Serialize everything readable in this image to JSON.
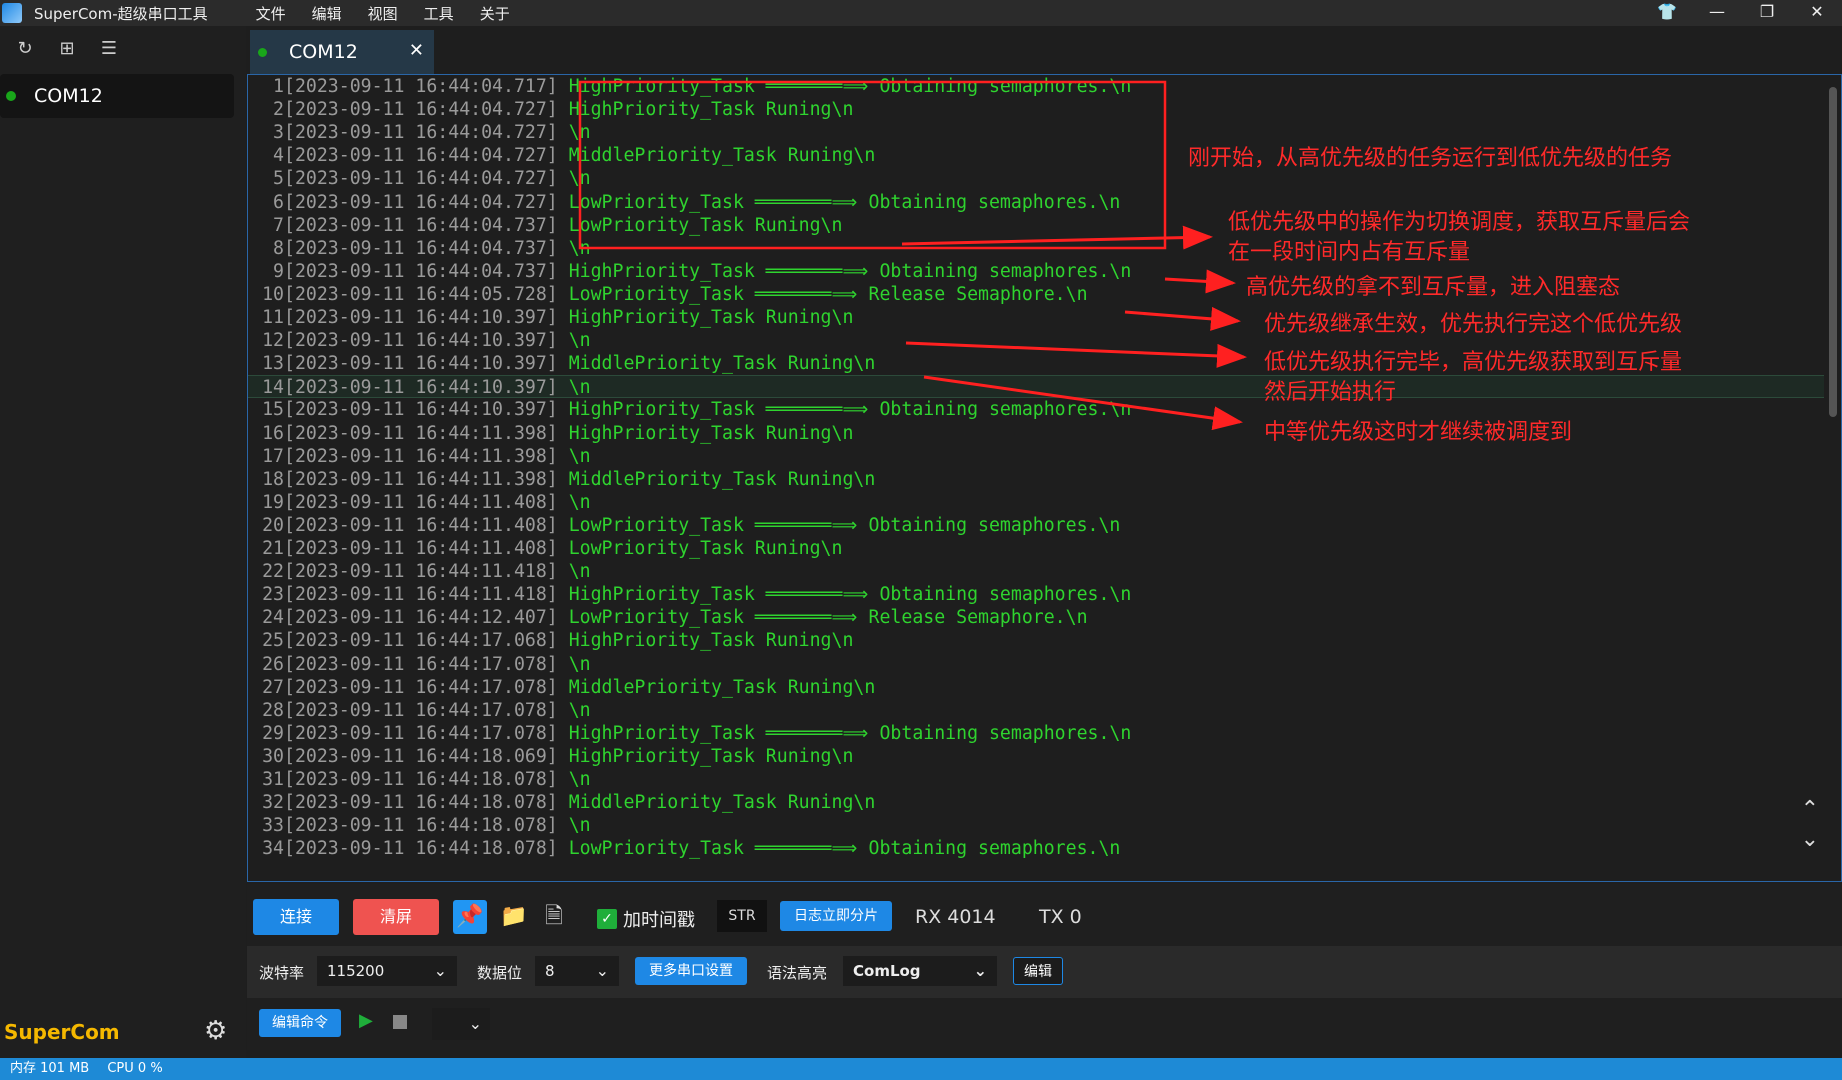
{
  "app": {
    "title": "SuperCom-超级串口工具",
    "menu": [
      "文件",
      "编辑",
      "视图",
      "工具",
      "关于"
    ],
    "brand": "SuperCom"
  },
  "sidebar": {
    "ports": [
      {
        "label": "COM12",
        "status": "connected",
        "status_color": "#19a61a"
      }
    ]
  },
  "tab": {
    "label": "COM12"
  },
  "terminal": {
    "lines": [
      {
        "n": "1",
        "ts": "[2023-09-11 16:44:04.717]",
        "msg": "HighPriority_Task ═══════⟹ Obtaining semaphores.\\n"
      },
      {
        "n": "2",
        "ts": "[2023-09-11 16:44:04.727]",
        "msg": "HighPriority_Task Runing\\n"
      },
      {
        "n": "3",
        "ts": "[2023-09-11 16:44:04.727]",
        "msg": "\\n"
      },
      {
        "n": "4",
        "ts": "[2023-09-11 16:44:04.727]",
        "msg": "MiddlePriority_Task Runing\\n"
      },
      {
        "n": "5",
        "ts": "[2023-09-11 16:44:04.727]",
        "msg": "\\n"
      },
      {
        "n": "6",
        "ts": "[2023-09-11 16:44:04.727]",
        "msg": "LowPriority_Task ═══════⟹ Obtaining semaphores.\\n"
      },
      {
        "n": "7",
        "ts": "[2023-09-11 16:44:04.737]",
        "msg": "LowPriority_Task Runing\\n"
      },
      {
        "n": "8",
        "ts": "[2023-09-11 16:44:04.737]",
        "msg": "\\n"
      },
      {
        "n": "9",
        "ts": "[2023-09-11 16:44:04.737]",
        "msg": "HighPriority_Task ═══════⟹ Obtaining semaphores.\\n"
      },
      {
        "n": "10",
        "ts": "[2023-09-11 16:44:05.728]",
        "msg": "LowPriority_Task ═══════⟹ Release Semaphore.\\n"
      },
      {
        "n": "11",
        "ts": "[2023-09-11 16:44:10.397]",
        "msg": "HighPriority_Task Runing\\n"
      },
      {
        "n": "12",
        "ts": "[2023-09-11 16:44:10.397]",
        "msg": "\\n"
      },
      {
        "n": "13",
        "ts": "[2023-09-11 16:44:10.397]",
        "msg": "MiddlePriority_Task Runing\\n"
      },
      {
        "n": "14",
        "ts": "[2023-09-11 16:44:10.397]",
        "msg": "\\n"
      },
      {
        "n": "15",
        "ts": "[2023-09-11 16:44:10.397]",
        "msg": "HighPriority_Task ═══════⟹ Obtaining semaphores.\\n"
      },
      {
        "n": "16",
        "ts": "[2023-09-11 16:44:11.398]",
        "msg": "HighPriority_Task Runing\\n"
      },
      {
        "n": "17",
        "ts": "[2023-09-11 16:44:11.398]",
        "msg": "\\n"
      },
      {
        "n": "18",
        "ts": "[2023-09-11 16:44:11.398]",
        "msg": "MiddlePriority_Task Runing\\n"
      },
      {
        "n": "19",
        "ts": "[2023-09-11 16:44:11.408]",
        "msg": "\\n"
      },
      {
        "n": "20",
        "ts": "[2023-09-11 16:44:11.408]",
        "msg": "LowPriority_Task ═══════⟹ Obtaining semaphores.\\n"
      },
      {
        "n": "21",
        "ts": "[2023-09-11 16:44:11.408]",
        "msg": "LowPriority_Task Runing\\n"
      },
      {
        "n": "22",
        "ts": "[2023-09-11 16:44:11.418]",
        "msg": "\\n"
      },
      {
        "n": "23",
        "ts": "[2023-09-11 16:44:11.418]",
        "msg": "HighPriority_Task ═══════⟹ Obtaining semaphores.\\n"
      },
      {
        "n": "24",
        "ts": "[2023-09-11 16:44:12.407]",
        "msg": "LowPriority_Task ═══════⟹ Release Semaphore.\\n"
      },
      {
        "n": "25",
        "ts": "[2023-09-11 16:44:17.068]",
        "msg": "HighPriority_Task Runing\\n"
      },
      {
        "n": "26",
        "ts": "[2023-09-11 16:44:17.078]",
        "msg": "\\n"
      },
      {
        "n": "27",
        "ts": "[2023-09-11 16:44:17.078]",
        "msg": "MiddlePriority_Task Runing\\n"
      },
      {
        "n": "28",
        "ts": "[2023-09-11 16:44:17.078]",
        "msg": "\\n"
      },
      {
        "n": "29",
        "ts": "[2023-09-11 16:44:17.078]",
        "msg": "HighPriority_Task ═══════⟹ Obtaining semaphores.\\n"
      },
      {
        "n": "30",
        "ts": "[2023-09-11 16:44:18.069]",
        "msg": "HighPriority_Task Runing\\n"
      },
      {
        "n": "31",
        "ts": "[2023-09-11 16:44:18.078]",
        "msg": "\\n"
      },
      {
        "n": "32",
        "ts": "[2023-09-11 16:44:18.078]",
        "msg": "MiddlePriority_Task Runing\\n"
      },
      {
        "n": "33",
        "ts": "[2023-09-11 16:44:18.078]",
        "msg": "\\n"
      },
      {
        "n": "34",
        "ts": "[2023-09-11 16:44:18.078]",
        "msg": "LowPriority_Task ═══════⟹ Obtaining semaphores.\\n"
      }
    ],
    "highlighted_line": "14",
    "annotations": [
      "刚开始，从高优先级的任务运行到低优先级的任务",
      "低优先级中的操作为切换调度，获取互斥量后会",
      "在一段时间内占有互斥量",
      "高优先级的拿不到互斥量，进入阻塞态",
      "优先级继承生效，优先执行完这个低优先级",
      "低优先级执行完毕，高优先级获取到互斥量",
      "然后开始执行",
      "中等优先级这时才继续被调度到"
    ],
    "annotation_color": "#ff2a2a"
  },
  "toolbar": {
    "connect": "连接",
    "clear": "清屏",
    "timestamp_label": "加时间戳",
    "timestamp_checked": true,
    "str": "STR",
    "split_log": "日志立即分片",
    "rx": "RX 4014",
    "tx": "TX 0"
  },
  "settings": {
    "baud_label": "波特率",
    "baud_value": "115200",
    "databits_label": "数据位",
    "databits_value": "8",
    "more": "更多串口设置",
    "syntax_label": "语法高亮",
    "syntax_value": "ComLog",
    "edit": "编辑"
  },
  "commands": {
    "edit": "编辑命令"
  },
  "status": {
    "memory": "内存 101 MB",
    "cpu": "CPU 0 %"
  }
}
